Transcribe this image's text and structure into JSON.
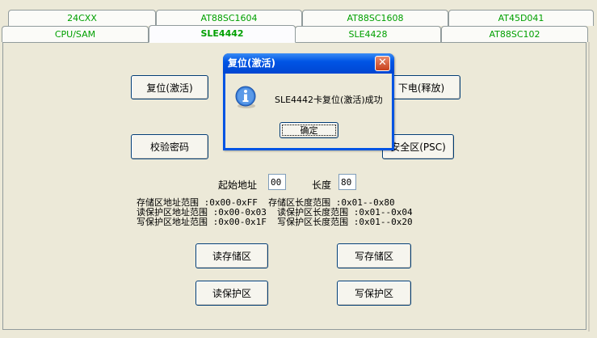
{
  "tabs_row1": [
    "24CXX",
    "AT88SC1604",
    "AT88SC1608",
    "AT45D041"
  ],
  "tabs_row2": [
    "CPU/SAM",
    "SLE4442",
    "SLE4428",
    "AT88SC102"
  ],
  "active_tab": "SLE4442",
  "buttons": {
    "reset": "复位(激活)",
    "power_off": "下电(释放)",
    "verify_pwd": "校验密码",
    "psc": "安全区(PSC)",
    "read_mem": "读存储区",
    "write_mem": "写存储区",
    "read_prot": "读保护区",
    "write_prot": "写保护区"
  },
  "fields": {
    "start_label": "起始地址",
    "start_value": "00",
    "length_label": "长度",
    "length_value": "80"
  },
  "info_lines": [
    "存储区地址范围 :0x00-0xFF  存储区长度范围 :0x01--0x80",
    "读保护区地址范围 :0x00-0x03  读保护区长度范围 :0x01--0x04",
    "写保护区地址范围 :0x00-0x1F  写保护区长度范围 :0x01--0x20"
  ],
  "dialog": {
    "title": "复位(激活)",
    "message": "SLE4442卡复位(激活)成功",
    "ok": "确定",
    "close": "✕"
  }
}
